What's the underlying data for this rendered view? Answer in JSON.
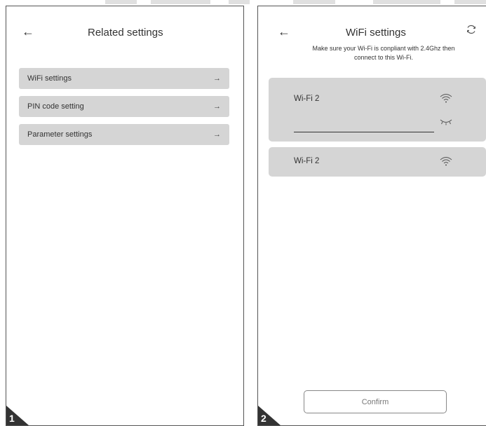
{
  "screen1": {
    "title": "Related settings",
    "back_icon": "back-arrow-icon",
    "items": [
      {
        "label": "WiFi settings",
        "arrow": "→"
      },
      {
        "label": "PIN code setting",
        "arrow": "→"
      },
      {
        "label": "Parameter settings",
        "arrow": "→"
      }
    ],
    "step": "1"
  },
  "screen2": {
    "title": "WiFi settings",
    "back_icon": "back-arrow-icon",
    "refresh_icon": "refresh-icon",
    "notice_line1": "Make sure your Wi-Fi is conpliant with 2.4Ghz then",
    "notice_line2": "connect to this Wi-Fi.",
    "networks": [
      {
        "name": "Wi-Fi 2",
        "icon": "wifi-icon",
        "expanded": true
      },
      {
        "name": "Wi-Fi 2",
        "icon": "wifi-icon",
        "expanded": false
      }
    ],
    "password_toggle_icon": "eye-closed-icon",
    "confirm_label": "Confirm",
    "step": "2"
  },
  "colors": {
    "card_bg": "#d5d5d5",
    "step_badge": "#333333",
    "border": "#555555"
  }
}
